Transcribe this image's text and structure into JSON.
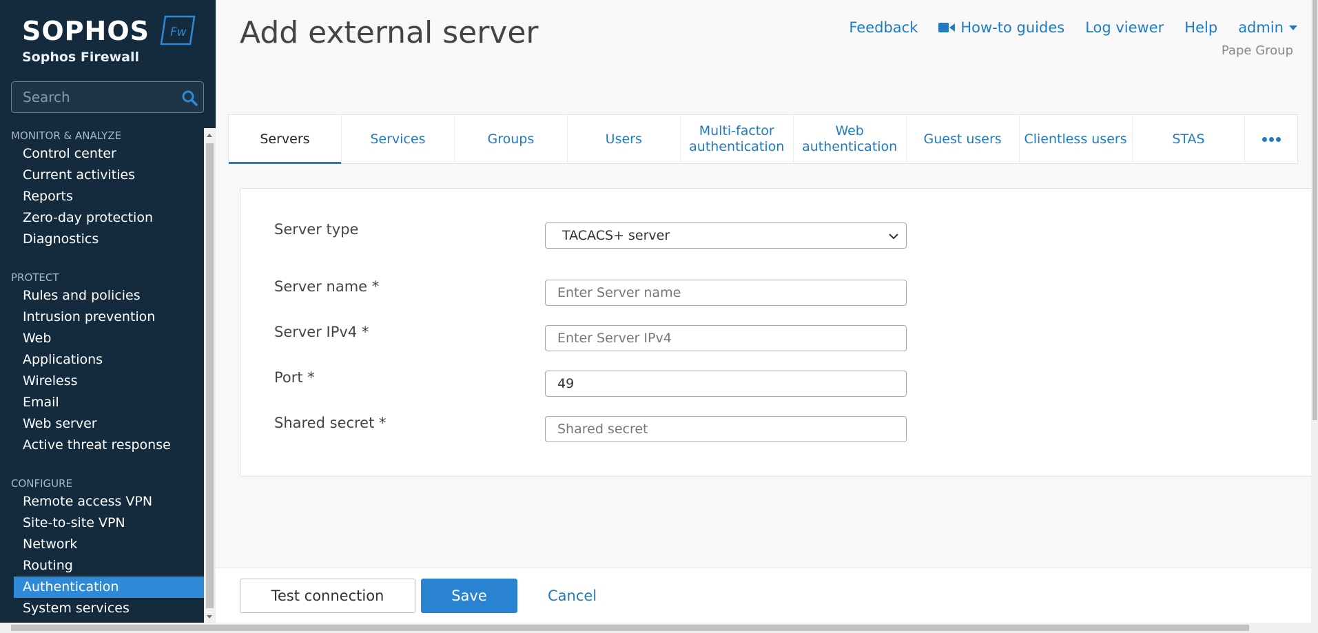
{
  "brand": {
    "logo_text": "SOPHOS",
    "logo_badge": "Fw",
    "product": "Sophos Firewall"
  },
  "search": {
    "placeholder": "Search"
  },
  "sidebar": {
    "sections": [
      {
        "title": "MONITOR & ANALYZE",
        "items": [
          "Control center",
          "Current activities",
          "Reports",
          "Zero-day protection",
          "Diagnostics"
        ]
      },
      {
        "title": "PROTECT",
        "items": [
          "Rules and policies",
          "Intrusion prevention",
          "Web",
          "Applications",
          "Wireless",
          "Email",
          "Web server",
          "Active threat response"
        ]
      },
      {
        "title": "CONFIGURE",
        "items": [
          "Remote access VPN",
          "Site-to-site VPN",
          "Network",
          "Routing",
          "Authentication",
          "System services"
        ]
      }
    ],
    "active_item": "Authentication"
  },
  "header": {
    "title": "Add external server",
    "links": {
      "feedback": "Feedback",
      "howto": "How-to guides",
      "logviewer": "Log viewer",
      "help": "Help",
      "user": "admin"
    },
    "org": "Pape Group"
  },
  "tabs": [
    {
      "label": "Servers",
      "active": true
    },
    {
      "label": "Services"
    },
    {
      "label": "Groups"
    },
    {
      "label": "Users"
    },
    {
      "label": "Multi-factor authentication"
    },
    {
      "label": "Web authentication"
    },
    {
      "label": "Guest users"
    },
    {
      "label": "Clientless users"
    },
    {
      "label": "STAS"
    }
  ],
  "form": {
    "server_type": {
      "label": "Server type",
      "value": "TACACS+ server"
    },
    "server_name": {
      "label": "Server name *",
      "placeholder": "Enter Server name",
      "value": ""
    },
    "server_ipv4": {
      "label": "Server IPv4 *",
      "placeholder": "Enter Server IPv4",
      "value": ""
    },
    "port": {
      "label": "Port *",
      "value": "49"
    },
    "shared_secret": {
      "label": "Shared secret *",
      "placeholder": "Shared secret",
      "value": ""
    }
  },
  "footer": {
    "test": "Test connection",
    "save": "Save",
    "cancel": "Cancel"
  },
  "colors": {
    "sidebar_bg": "#132b3d",
    "accent": "#1f7bc1",
    "active_nav": "#2e8ad6",
    "save_button": "#2a83d0"
  }
}
